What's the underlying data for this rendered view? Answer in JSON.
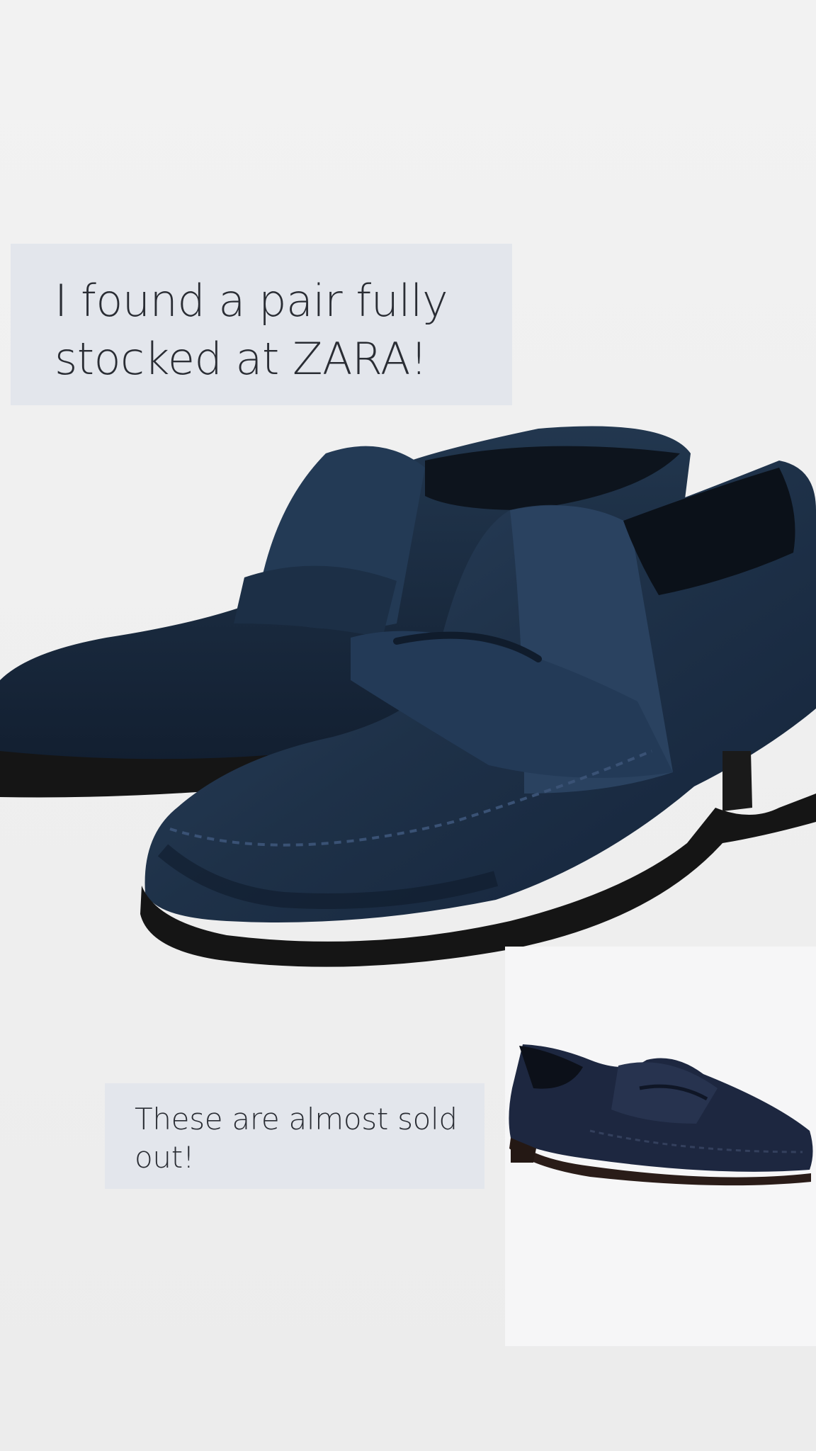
{
  "story": {
    "caption_large": "I found a pair fully stocked at ZARA!",
    "caption_small": "These are almost sold out!"
  },
  "product": {
    "main_image": "navy-suede-penny-loafers-pair-icon",
    "inset_image": "navy-suede-penny-loafer-single-icon"
  },
  "colors": {
    "background": "#efefef",
    "caption_bg": "#e3e6ec",
    "caption_text": "#2a2d34",
    "suede_navy": "#1e3148",
    "sole": "#151515"
  }
}
